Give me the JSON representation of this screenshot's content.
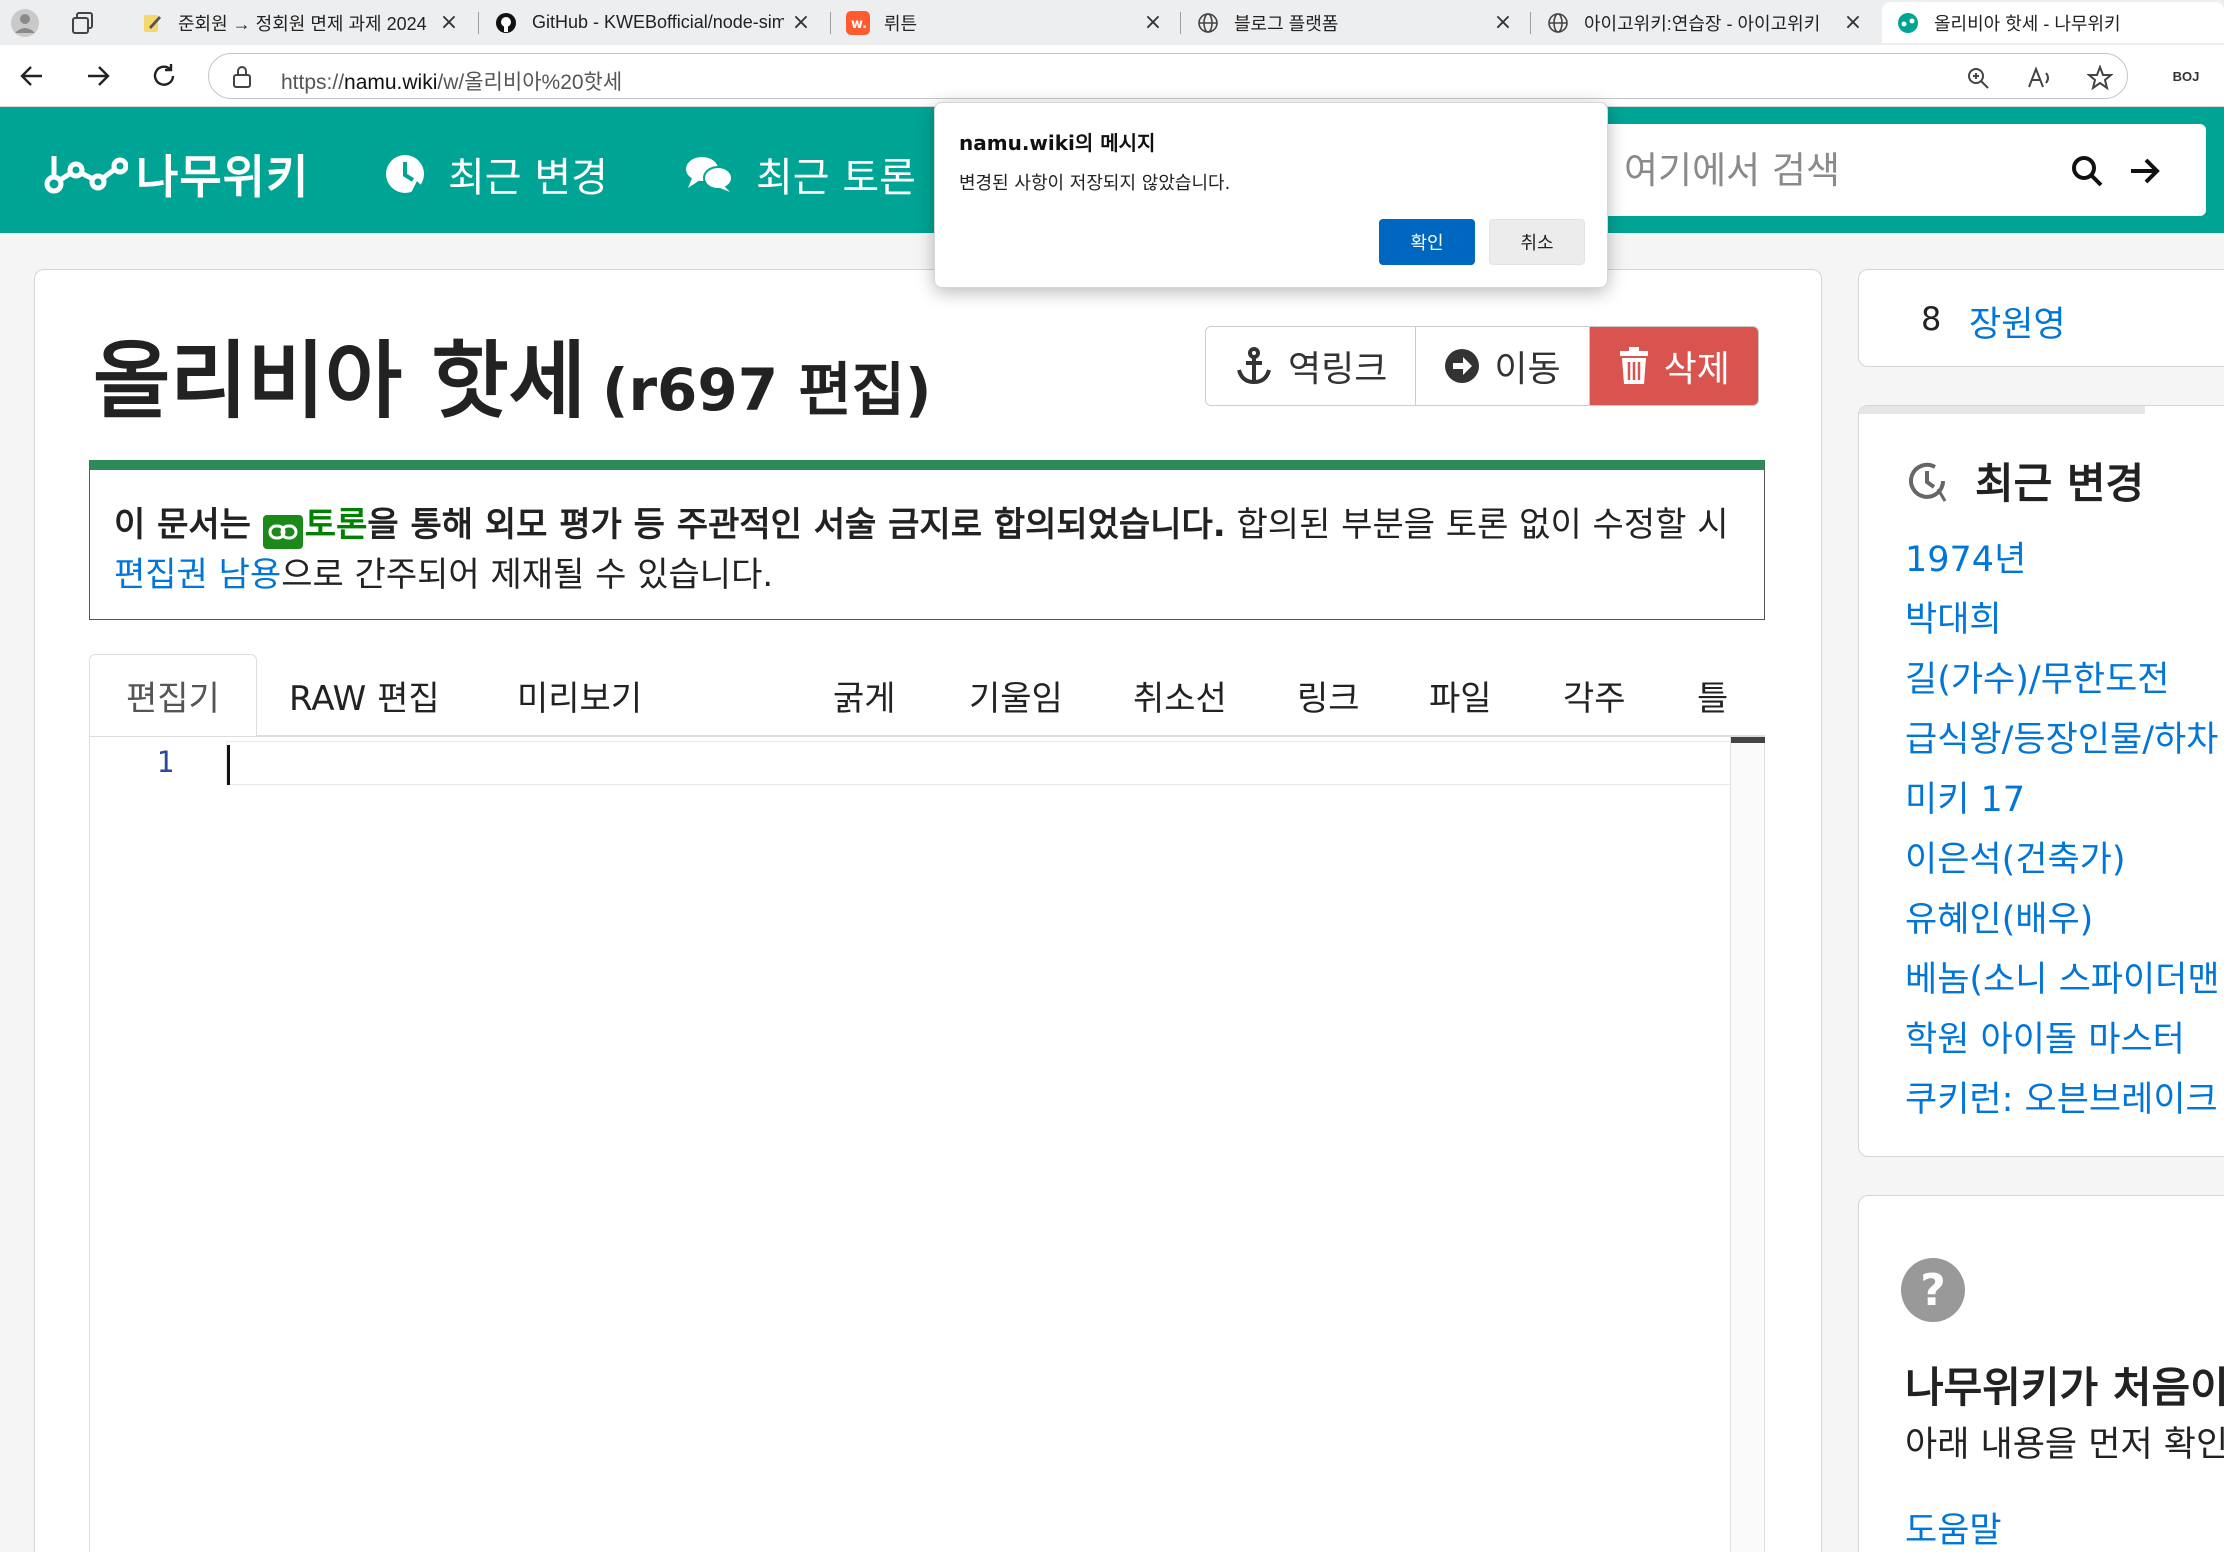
{
  "browser": {
    "tabs": [
      {
        "title": "준회원 → 정회원 면제 과제 2024",
        "favicon": "notepad-icon"
      },
      {
        "title": "GitHub - KWEBofficial/node-simp",
        "favicon": "github-icon"
      },
      {
        "title": "뤼튼",
        "favicon": "wrtn-icon"
      },
      {
        "title": "블로그 플랫폼",
        "favicon": "globe-icon"
      },
      {
        "title": "아이고위키:연습장 - 아이고위키",
        "favicon": "globe-icon"
      },
      {
        "title": "올리비아 핫세 - 나무위키",
        "favicon": "namu-icon",
        "active": true
      }
    ],
    "url_prefix": "https://",
    "url_domain": "namu.wiki",
    "url_path": "/w/올리비아%20핫세",
    "ext_label": "BOJ"
  },
  "header": {
    "logo": "나무위키",
    "nav": [
      "최근 변경",
      "최근 토론"
    ],
    "search_placeholder": "여기에서 검색",
    "brand_color": "#00a495"
  },
  "article": {
    "title": "올리비아 핫세",
    "revision": "(r697 편집)",
    "actions": {
      "backlink": "역링크",
      "move": "이동",
      "delete": "삭제"
    },
    "notice": {
      "part1": "이 문서는 ",
      "link": "토론",
      "part2": "을 통해 외모 평가 등 주관적인 서술 금지로 합의되었습니다.",
      "part3": " 합의된 부분을 토론 없이 수정할 시 ",
      "link2": "편집권 남용",
      "part4": "으로 간주되어 제재될 수 있습니다."
    },
    "tabs": [
      "편집기",
      "RAW 편집",
      "미리보기"
    ],
    "tools": [
      "굵게",
      "기울임",
      "취소선",
      "링크",
      "파일",
      "각주",
      "틀"
    ],
    "line_number": "1"
  },
  "sidebar": {
    "rank": {
      "number": "8",
      "word": "장원영"
    },
    "recent_title": "최근 변경",
    "recent_items": [
      "1974년",
      "박대희",
      "길(가수)/무한도전",
      "급식왕/등장인물/하차",
      "미키 17",
      "이은석(건축가)",
      "유혜인(배우)",
      "베놈(소니 스파이더맨",
      "학원 아이돌 마스터",
      "쿠키런: 오븐브레이크"
    ],
    "help_title": "나무위키가 처음이",
    "help_sub": "아래 내용을 먼저 확인",
    "help_link": "도움말"
  },
  "dialog": {
    "title": "namu.wiki의 메시지",
    "message": "변경된 사항이 저장되지 않았습니다.",
    "ok": "확인",
    "cancel": "취소"
  }
}
